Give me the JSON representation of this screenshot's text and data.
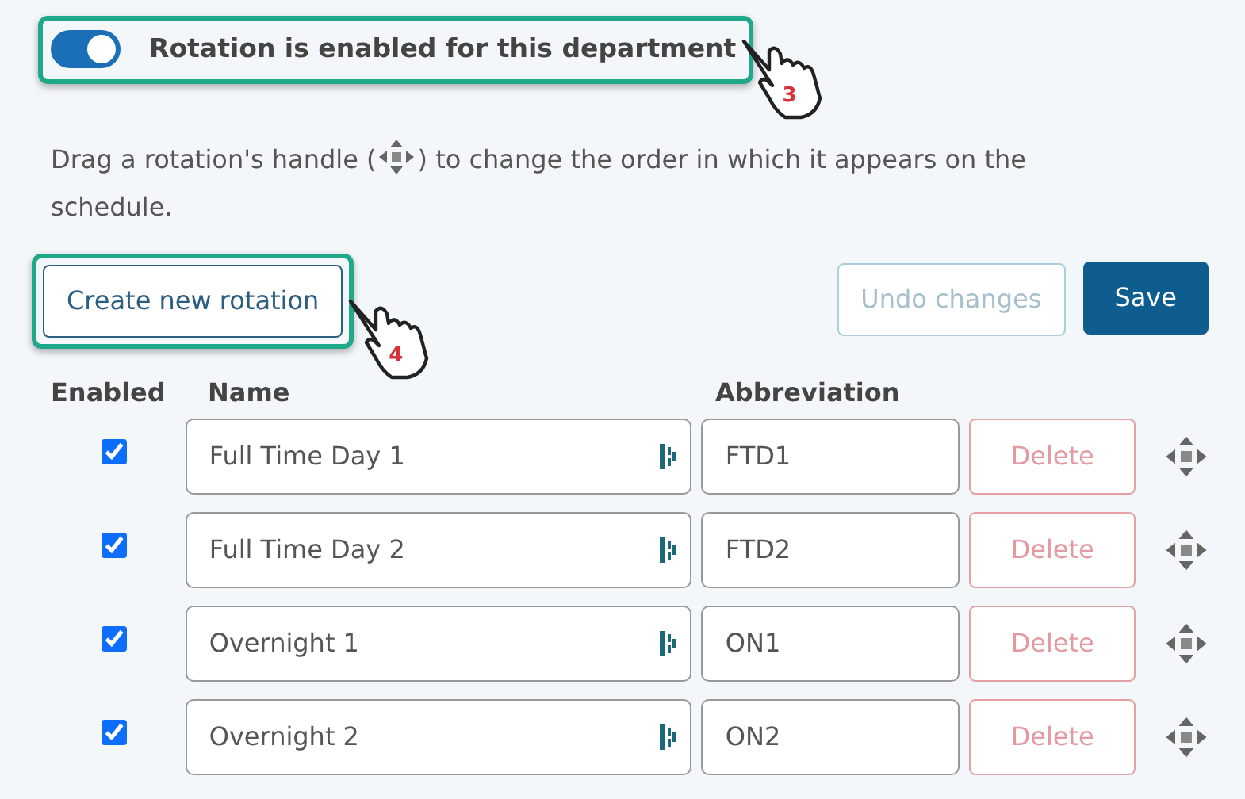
{
  "toggle": {
    "label": "Rotation is enabled for this department",
    "on": true,
    "callout": "3"
  },
  "instructions": [
    "Drag a rotation's handle (",
    ") to change the order in which it appears on the schedule."
  ],
  "create_button": {
    "label": "Create new rotation",
    "callout": "4"
  },
  "undo_button": {
    "label": "Undo changes",
    "disabled": true
  },
  "save_button": {
    "label": "Save",
    "disabled": false
  },
  "columns": [
    "Enabled",
    "Name",
    "Abbreviation"
  ],
  "rows": [
    {
      "enabled": true,
      "name": "Full Time Day 1",
      "abbreviation": "FTD1",
      "delete": "Delete",
      "delete_disabled": true
    },
    {
      "enabled": true,
      "name": "Full Time Day 2",
      "abbreviation": "FTD2",
      "delete": "Delete",
      "delete_disabled": true
    },
    {
      "enabled": true,
      "name": "Overnight 1",
      "abbreviation": "ON1",
      "delete": "Delete",
      "delete_disabled": true
    },
    {
      "enabled": true,
      "name": "Overnight 2",
      "abbreviation": "ON2",
      "delete": "Delete",
      "delete_disabled": true
    }
  ]
}
